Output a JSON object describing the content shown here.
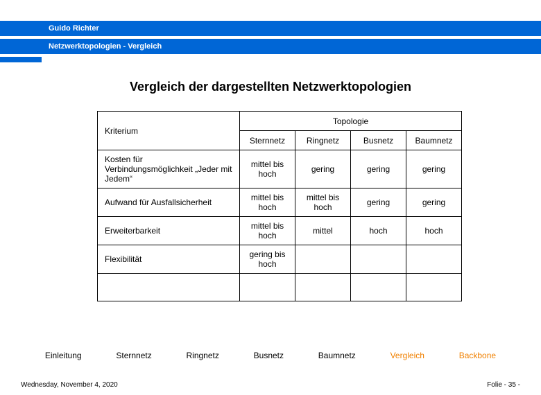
{
  "header": {
    "author": "Guido Richter",
    "breadcrumb": "Netzwerktopologien  - Vergleich"
  },
  "title": "Vergleich der dargestellten Netzwerktopologien",
  "table": {
    "criterion_label": "Kriterium",
    "topology_label": "Topologie",
    "cols": [
      "Sternnetz",
      "Ringnetz",
      "Busnetz",
      "Baumnetz"
    ],
    "rows": [
      {
        "label": "Kosten für Verbindungsmöglichkeit „Jeder mit Jedem“",
        "vals": [
          "mittel bis hoch",
          "gering",
          "gering",
          "gering"
        ]
      },
      {
        "label": "Aufwand für Ausfallsicherheit",
        "vals": [
          "mittel bis hoch",
          "mittel bis hoch",
          "gering",
          "gering"
        ]
      },
      {
        "label": "Erweiterbarkeit",
        "vals": [
          "mittel bis hoch",
          "mittel",
          "hoch",
          "hoch"
        ]
      },
      {
        "label": "Flexibilität",
        "vals": [
          "gering bis hoch",
          "",
          "",
          ""
        ]
      },
      {
        "label": "",
        "vals": [
          "",
          "",
          "",
          ""
        ]
      }
    ]
  },
  "nav": {
    "einleitung": "Einleitung",
    "sternnetz": "Sternnetz",
    "ringnetz": "Ringnetz",
    "busnetz": "Busnetz",
    "baumnetz": "Baumnetz",
    "vergleich": "Vergleich",
    "backbone": "Backbone"
  },
  "footer": {
    "date": "Wednesday, November 4, 2020",
    "page": "Folie - 35 -"
  }
}
